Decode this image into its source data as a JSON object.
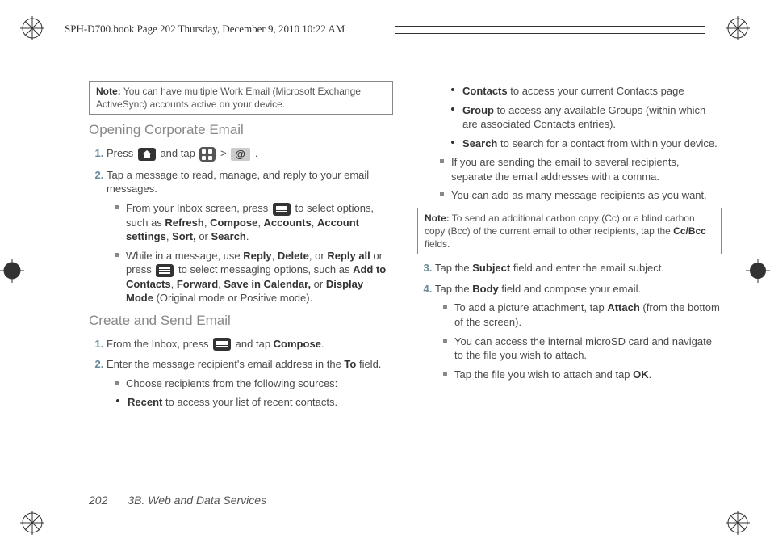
{
  "header": "SPH-D700.book  Page 202  Thursday, December 9, 2010  10:22 AM",
  "note1_label": "Note:",
  "note1": "You can have multiple Work Email (Microsoft Exchange ActiveSync) accounts active on your device.",
  "h_open": "Opening Corporate Email",
  "s1_1a": "Press ",
  "s1_1b": " and tap ",
  "s1_1c": " > ",
  "s1_1d": " .",
  "s1_2": "Tap a message to read, manage, and reply to your email messages.",
  "s1_2a_a": "From your Inbox screen, press ",
  "s1_2a_b": " to select options, such as ",
  "b_refresh": "Refresh",
  "b_compose": "Compose",
  "b_accounts": "Accounts",
  "b_acct": "Account settings",
  "b_sort": "Sort,",
  "b_search": "Search",
  "s1_2b_a": "While in a message, use ",
  "b_reply": "Reply",
  "b_delete": "Delete",
  "s1_2b_b": ", or ",
  "b_replyall": "Reply all",
  "s1_2b_c": " or press ",
  "s1_2b_d": " to select messaging options, such as ",
  "b_addc": "Add to Contacts",
  "b_fwd": "Forward",
  "b_save": "Save in Calendar,",
  "b_disp": "Display Mode",
  "s1_2b_e": " (Original mode or Positive mode).",
  "h_create": "Create and Send Email",
  "s2_1a": "From the Inbox, press ",
  "s2_1b": " and tap ",
  "s2_2a": "Enter the message recipient's email address in the ",
  "b_to": "To",
  "s2_2b": " field.",
  "s2_2c": "Choose recipients from the following sources:",
  "b_recent": "Recent",
  "d_recent": " to access your list of recent contacts.",
  "b_contacts": "Contacts",
  "d_contacts": " to access your current Contacts page",
  "b_group": "Group",
  "d_group": " to access any available Groups (within which are associated Contacts entries).",
  "b_srch": "Search",
  "d_srch": " to search for a contact from within your device.",
  "r_multi": "If you are sending the email to several recipients, separate the email addresses with a comma.",
  "r_many": "You can add as many message recipients as you want.",
  "note2_label": "Note:",
  "note2a": "To send an additional carbon copy (Cc) or a blind carbon copy (Bcc) of the current email to other recipients, tap the ",
  "b_ccbcc": "Cc/Bcc",
  "note2b": " fields.",
  "s3a": "Tap the ",
  "b_subj": "Subject",
  "s3b": " field and enter the email subject.",
  "s4a": "Tap the ",
  "b_body": "Body",
  "s4b": " field and compose your email.",
  "s4_1a": "To add a picture attachment, tap ",
  "b_attach": "Attach",
  "s4_1b": " (from the bottom of the screen).",
  "s4_2": "You can access the internal microSD card and navigate to the file you wish to attach.",
  "s4_3a": "Tap the file you wish to attach and tap ",
  "b_ok": "OK",
  "s4_3b": ".",
  "page_num": "202",
  "section": "3B. Web and Data Services",
  "comma": ", ",
  "or": " or ",
  "period": "."
}
